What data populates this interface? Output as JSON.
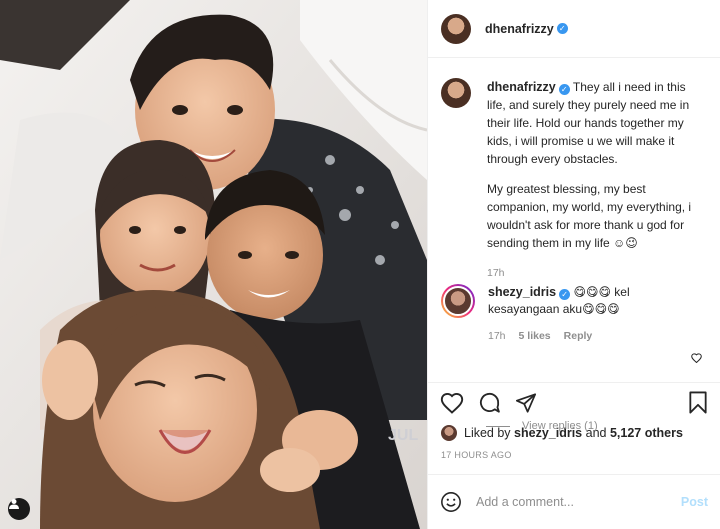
{
  "post": {
    "username": "dhenafrizzy",
    "verified_mark": "✓"
  },
  "caption": {
    "username": "dhenafrizzy",
    "paragraph1": "They all i need in this life, and surely they purely need me in their life. Hold our hands together my kids, i will promise u we will make it through every obstacles.",
    "paragraph2": "My greatest blessing, my best companion, my world, my everything, i wouldn't ask for more thank u god for sending them in my life ☺😉",
    "time": "17h"
  },
  "comment": {
    "username": "shezy_idris",
    "text": "😋😋😋 kel kesayangaan aku😋😋😋",
    "time": "17h",
    "likes": "5 likes",
    "reply_label": "Reply",
    "view_replies": "View replies (1)"
  },
  "likes": {
    "prefix": "Liked by",
    "user": "shezy_idris",
    "middle": "and",
    "count": "5,127 others"
  },
  "timestamp": "17 HOURS AGO",
  "add_comment": {
    "placeholder": "Add a comment...",
    "post_label": "Post"
  },
  "icons": {
    "photo_tag": "person-tag-icon",
    "heart": "heart-icon",
    "comment": "comment-icon",
    "share": "share-icon",
    "save": "bookmark-icon",
    "emoji": "smiley-icon"
  },
  "colors": {
    "link_blue": "#b2dffc",
    "verified_blue": "#3897f0",
    "muted": "#8e8e8e"
  }
}
